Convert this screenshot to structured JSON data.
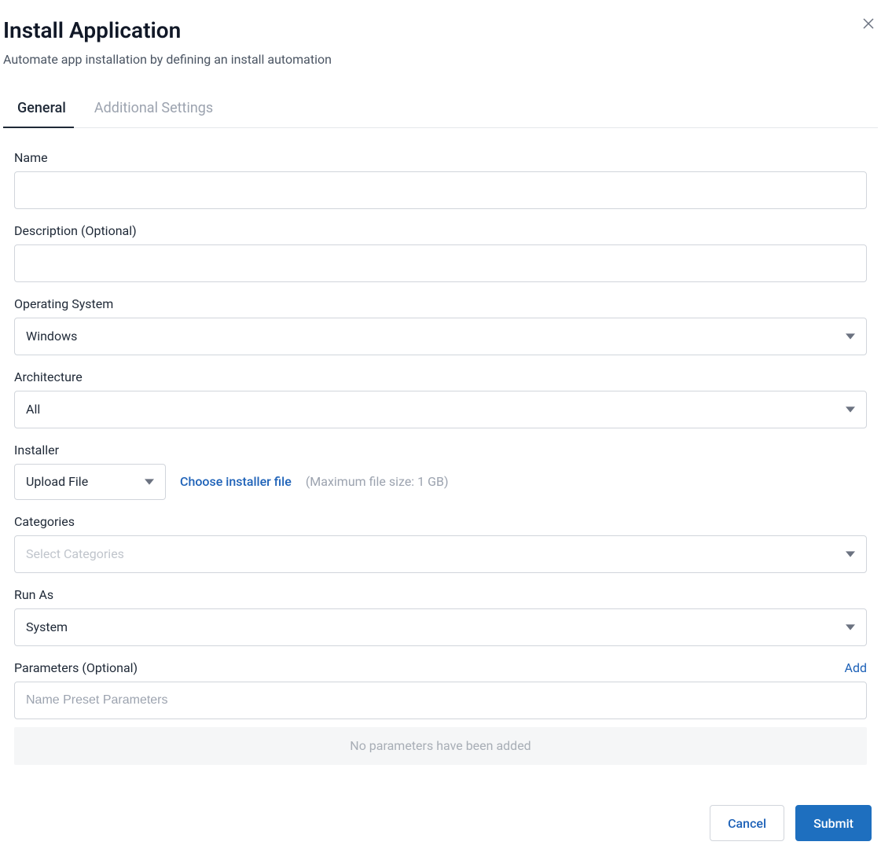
{
  "header": {
    "title": "Install Application",
    "subtitle": "Automate app installation by defining an install automation"
  },
  "tabs": {
    "general": "General",
    "additional": "Additional Settings",
    "active": "general"
  },
  "form": {
    "name": {
      "label": "Name",
      "value": ""
    },
    "description": {
      "label": "Description (Optional)",
      "value": ""
    },
    "os": {
      "label": "Operating System",
      "value": "Windows"
    },
    "architecture": {
      "label": "Architecture",
      "value": "All"
    },
    "installer": {
      "label": "Installer",
      "method": "Upload File",
      "choose_label": "Choose installer file",
      "hint": "(Maximum file size: 1 GB)"
    },
    "categories": {
      "label": "Categories",
      "placeholder": "Select Categories",
      "value": ""
    },
    "run_as": {
      "label": "Run As",
      "value": "System"
    },
    "parameters": {
      "label": "Parameters (Optional)",
      "add_label": "Add",
      "placeholder": "Name Preset Parameters",
      "value": "",
      "empty_text": "No parameters have been added"
    }
  },
  "footer": {
    "cancel": "Cancel",
    "submit": "Submit"
  }
}
